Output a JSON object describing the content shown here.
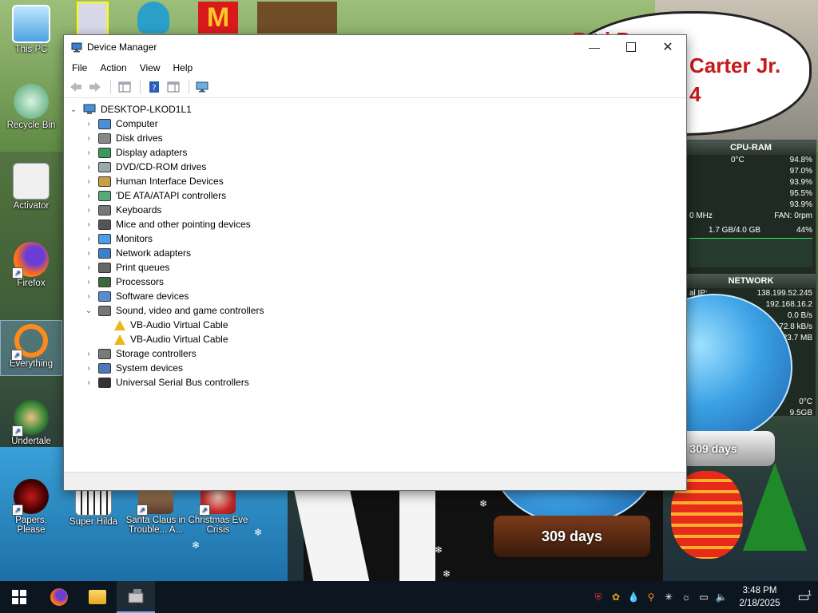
{
  "desktop": {
    "bubble_lines": [
      "P  t i  P     e",
      "Carter Jr.",
      "4"
    ],
    "icons": [
      {
        "label": "This PC",
        "icon": "this-pc-icon"
      },
      {
        "label": "Recycle Bin",
        "icon": "recycle-bin-icon"
      },
      {
        "label": "Activator",
        "icon": "activator-icon"
      },
      {
        "label": "Firefox",
        "icon": "firefox-icon"
      },
      {
        "label": "Everything",
        "icon": "everything-search-icon"
      },
      {
        "label": "Undertale",
        "icon": "undertale-icon"
      },
      {
        "label": "Papers, Please",
        "icon": "papers-please-icon"
      },
      {
        "label": "Super Hilda",
        "icon": "super-hilda-icon"
      },
      {
        "label": "Santa Claus in Trouble... A...",
        "icon": "santa-claus-icon"
      },
      {
        "label": "Christmas Eve Crisis",
        "icon": "christmas-eve-icon"
      }
    ]
  },
  "gadget": {
    "cpu_title": "CPU-RAM",
    "temp": "0°C",
    "cpu_load": "94.8%",
    "cores": [
      "97.0%",
      "93.9%",
      "95.5%",
      "93.9%"
    ],
    "mhz": "0 MHz",
    "fan": "FAN: 0rpm",
    "ram": "1.7 GB/4.0 GB",
    "ram_pct": "44%",
    "network_title": "NETWORK",
    "external_ip_label": "al IP:",
    "external_ip": "138.199.52.245",
    "internal_ip": "192.168.16.2",
    "net_speed": "0.0 B/s",
    "net_up": "72.8 kB/s",
    "net_total": "23.7 MB",
    "disk_temp": "0°C",
    "disk_free": "9.5GB"
  },
  "globes": {
    "left_days": "309 days",
    "right_days": "309 days"
  },
  "window": {
    "title": "Device Manager",
    "menu": [
      "File",
      "Action",
      "View",
      "Help"
    ],
    "tree": {
      "root": "DESKTOP-LKOD1L1",
      "nodes": [
        {
          "label": "Computer",
          "icon": "computer-icon",
          "expanded": false
        },
        {
          "label": "Disk drives",
          "icon": "disk-drive-icon",
          "expanded": false
        },
        {
          "label": "Display adapters",
          "icon": "display-adapter-icon",
          "expanded": false
        },
        {
          "label": "DVD/CD-ROM drives",
          "icon": "dvd-drive-icon",
          "expanded": false
        },
        {
          "label": "Human Interface Devices",
          "icon": "hid-icon",
          "expanded": false
        },
        {
          "label": "'DE ATA/ATAPI controllers",
          "icon": "ide-controller-icon",
          "expanded": false
        },
        {
          "label": "Keyboards",
          "icon": "keyboard-icon",
          "expanded": false
        },
        {
          "label": "Mice and other pointing devices",
          "icon": "mouse-icon",
          "expanded": false
        },
        {
          "label": "Monitors",
          "icon": "monitor-icon",
          "expanded": false
        },
        {
          "label": "Network adapters",
          "icon": "network-adapter-icon",
          "expanded": false
        },
        {
          "label": "Print queues",
          "icon": "printer-icon",
          "expanded": false
        },
        {
          "label": "Processors",
          "icon": "processor-icon",
          "expanded": false
        },
        {
          "label": "Software devices",
          "icon": "software-device-icon",
          "expanded": false
        },
        {
          "label": "Sound, video and game controllers",
          "icon": "speaker-icon",
          "expanded": true,
          "children": [
            {
              "label": "VB-Audio Virtual Cable",
              "icon": "warning-audio-device-icon"
            },
            {
              "label": "VB-Audio Virtual Cable",
              "icon": "warning-audio-device-icon"
            }
          ]
        },
        {
          "label": "Storage controllers",
          "icon": "storage-controller-icon",
          "expanded": false
        },
        {
          "label": "System devices",
          "icon": "system-device-icon",
          "expanded": false
        },
        {
          "label": "Universal Serial Bus controllers",
          "icon": "usb-icon",
          "expanded": false
        }
      ]
    }
  },
  "taskbar": {
    "time": "3:48 PM",
    "date": "2/18/2025",
    "notification_count": "1"
  }
}
